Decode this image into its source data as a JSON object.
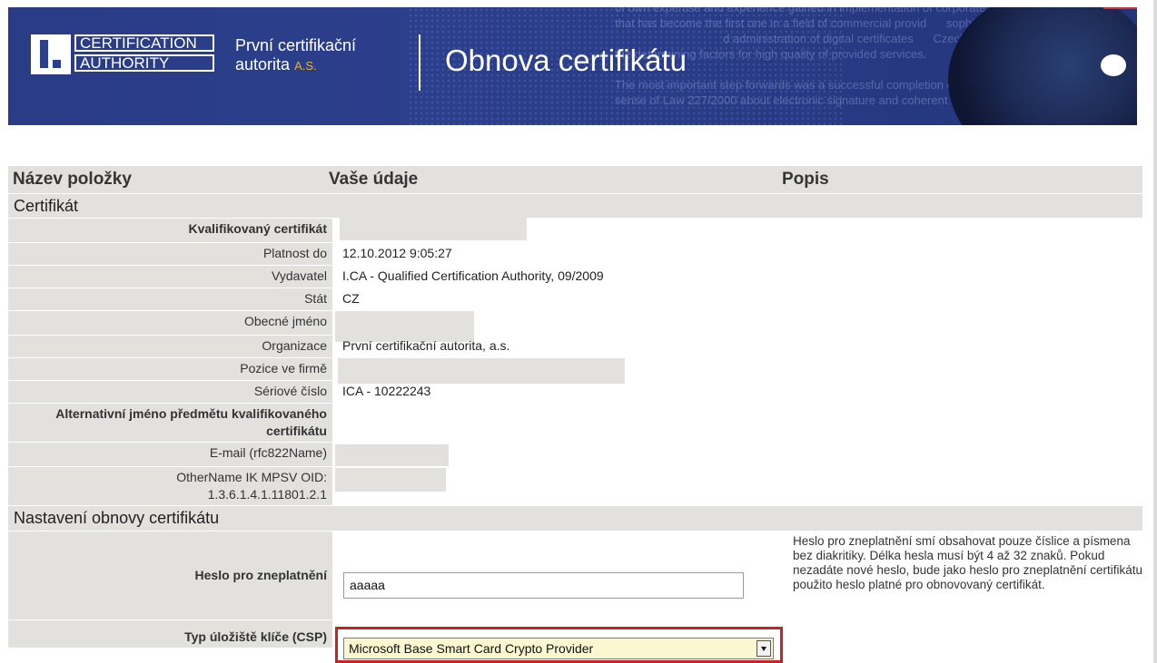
{
  "banner": {
    "logo_line1": "CERTIFICATION",
    "logo_line2": "AUTHORITY",
    "company_line1": "První certifikační",
    "company_line2": "autorita",
    "company_suffix": "A.S.",
    "page_title": "Obnova certifikátu",
    "background_text": "of own expertise and experience gained in implementation of corporate\nthat has become the first one in a field of commercial provid      sophisticated services\n                                 d administration of digital certificates      Czech\nthe determining factors for high quality of provided services.\n\nThe most important step forwards was a successful completion of accreditation process in\nsense of Law 227/2000 about electronic signature and coherent edicts. The Office for"
  },
  "table": {
    "headers": [
      "Název položky",
      "Vaše údaje",
      "Popis"
    ],
    "section_certificate": "Certifikát",
    "rows": [
      {
        "label": "Kvalifikovaný certifikát",
        "value": "",
        "bold": true
      },
      {
        "label": "Platnost do",
        "value": "12.10.2012 9:05:27"
      },
      {
        "label": "Vydavatel",
        "value": "I.CA - Qualified Certification Authority, 09/2009"
      },
      {
        "label": "Stát",
        "value": "CZ"
      },
      {
        "label": "Obecné jméno",
        "value": ""
      },
      {
        "label": "Organizace",
        "value": "První certifikační autorita, a.s."
      },
      {
        "label": "Pozice ve firmě",
        "value": ""
      },
      {
        "label": "Sériové číslo",
        "value": "ICA - 10222243"
      }
    ],
    "alt_name_label_1": "Alternativní jméno předmětu kvalifikovaného",
    "alt_name_label_2": "certifikátu",
    "email_label": "E-mail (rfc822Name)",
    "othername_label_1": "OtherName IK MPSV OID:",
    "othername_label_2": "1.3.6.1.4.1.11801.2.1",
    "section_renewal": "Nastavení obnovy certifikátu",
    "password_label": "Heslo pro zneplatnění",
    "password_value": "aaaaa",
    "password_desc": "Heslo pro zneplatnění smí obsahovat pouze číslice a písmena bez diakritiky. Délka hesla musí být 4 až 32 znaků. Pokud nezadáte nové heslo, bude jako heslo pro zneplatnění certifikátu použito heslo platné pro obnovovaný certifikát.",
    "csp_label": "Typ úložiště klíče (CSP)",
    "csp_selected": "Microsoft Base Smart Card Crypto Provider"
  },
  "colors": {
    "banner_blue": "#2c3f8c",
    "label_gray": "#e3e1de",
    "highlight_red": "#d11f1f",
    "select_bg": "#fbf7d0",
    "accent_gold": "#e6b427"
  }
}
